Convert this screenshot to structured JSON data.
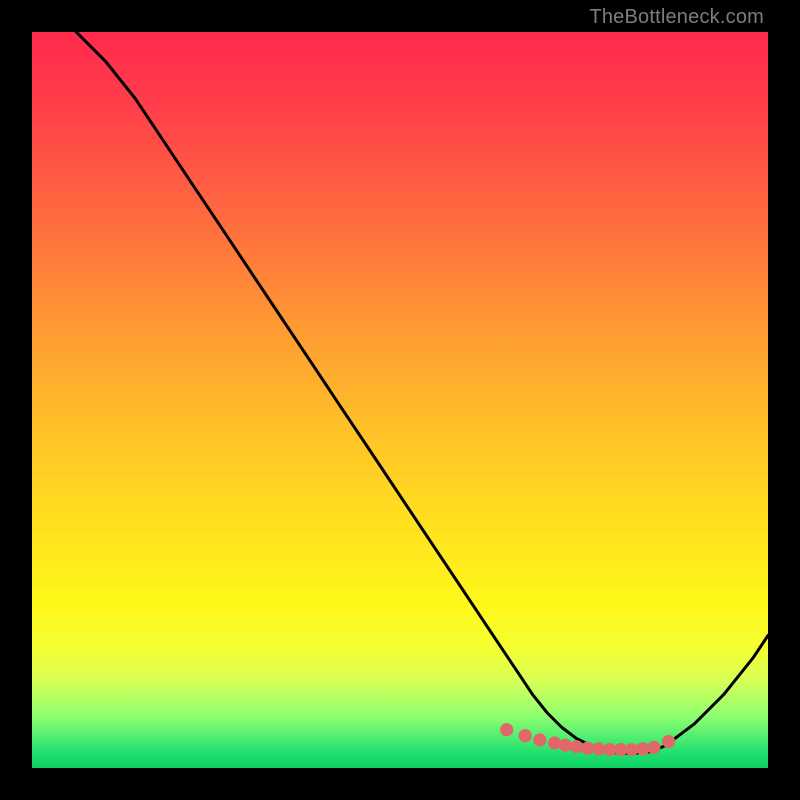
{
  "watermark": "TheBottleneck.com",
  "chart_data": {
    "type": "line",
    "title": "",
    "xlabel": "",
    "ylabel": "",
    "xlim": [
      0,
      100
    ],
    "ylim": [
      0,
      100
    ],
    "grid": false,
    "series": [
      {
        "name": "bottleneck-curve",
        "color": "#000000",
        "x": [
          6,
          10,
          14,
          18,
          22,
          26,
          30,
          34,
          38,
          42,
          46,
          50,
          54,
          58,
          62,
          64,
          66,
          68,
          70,
          72,
          74,
          76,
          78,
          80,
          82,
          84,
          86,
          90,
          94,
          98,
          100
        ],
        "y": [
          100,
          96,
          91,
          85,
          79,
          73,
          67,
          61,
          55,
          49,
          43,
          37,
          31,
          25,
          19,
          16,
          13,
          10,
          7.5,
          5.5,
          4,
          3,
          2.2,
          2,
          2,
          2.2,
          3,
          6,
          10,
          15,
          18
        ]
      }
    ],
    "markers": {
      "name": "optimal-range-dots",
      "color": "#e16868",
      "radius_logical": 0.9,
      "x": [
        64.5,
        67,
        69,
        71,
        72.5,
        74,
        75.5,
        77,
        78.5,
        80,
        81.5,
        83,
        84.5,
        86.5
      ],
      "y": [
        5.2,
        4.4,
        3.8,
        3.4,
        3.1,
        2.9,
        2.7,
        2.6,
        2.5,
        2.5,
        2.5,
        2.6,
        2.8,
        3.6
      ]
    }
  },
  "colors": {
    "curve": "#000000",
    "marker": "#e16868",
    "frame": "#000000"
  }
}
